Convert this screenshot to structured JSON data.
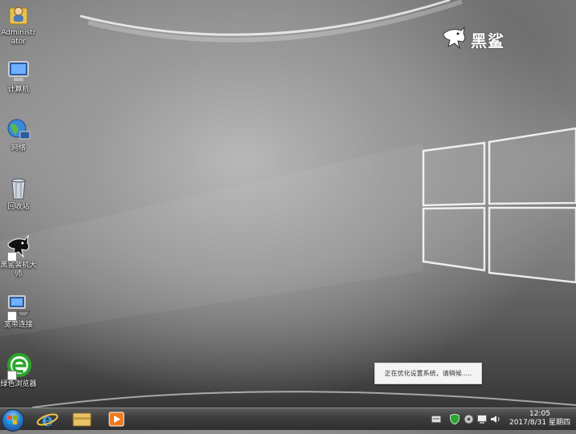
{
  "desktop": {
    "icons": [
      {
        "label": "Administrator",
        "icon": "user-folder-icon"
      },
      {
        "label": "计算机",
        "icon": "computer-icon"
      },
      {
        "label": "网络",
        "icon": "network-globe-icon"
      },
      {
        "label": "回收站",
        "icon": "recycle-bin-icon"
      },
      {
        "label": "黑鲨装机大师",
        "icon": "shark-app-icon"
      },
      {
        "label": "宽带连接",
        "icon": "broadband-connection-icon"
      },
      {
        "label": "绿色浏览器",
        "icon": "green-browser-icon"
      }
    ]
  },
  "brand": {
    "text": "黑鲨",
    "icon": "shark-logo-icon"
  },
  "notification": {
    "text": "正在优化设置系统，请稍候....."
  },
  "taskbar": {
    "pinned": [
      {
        "icon": "internet-explorer-icon"
      },
      {
        "icon": "file-explorer-icon"
      },
      {
        "icon": "media-player-icon"
      }
    ],
    "tray_icons": [
      "keyboard-icon",
      "security-shield-icon",
      "network-tray-icon",
      "action-center-icon",
      "volume-icon"
    ],
    "clock": {
      "time": "12:05",
      "date": "2017/8/31 星期四"
    }
  }
}
